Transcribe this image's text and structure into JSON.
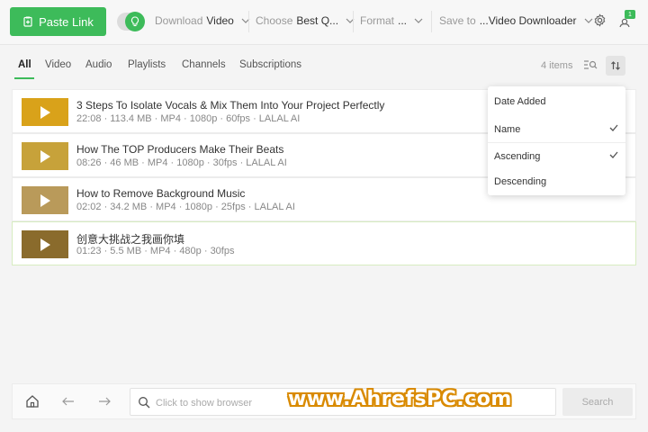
{
  "toolbar": {
    "paste_link_label": "Paste Link",
    "download_label": "Download",
    "download_value": "Video",
    "choose_label": "Choose",
    "choose_value": "Best Q...",
    "format_label": "Format",
    "format_value": "...",
    "save_to_label": "Save to",
    "save_to_value": "...Video Downloader",
    "badge_count": "1",
    "accent_color": "#3dbb5a"
  },
  "tabs": [
    {
      "label": "All",
      "active": true
    },
    {
      "label": "Video"
    },
    {
      "label": "Audio"
    },
    {
      "label": "Playlists"
    },
    {
      "label": "Channels"
    },
    {
      "label": "Subscriptions"
    }
  ],
  "items_count": "4 items",
  "list": [
    {
      "title": "3 Steps To Isolate Vocals & Mix Them Into Your Project Perfectly",
      "meta": "22:08 · 113.4 MB · MP4 · 1080p · 60fps · LALAL AI",
      "thumb_color": "#d9a21a"
    },
    {
      "title": "How The TOP Producers Make Their Beats",
      "meta": "08:26 · 46 MB · MP4 · 1080p · 30fps · LALAL AI",
      "thumb_color": "#c7a23a"
    },
    {
      "title": "How to Remove Background Music",
      "meta": "02:02 · 34.2 MB · MP4 · 1080p · 25fps · LALAL AI",
      "thumb_color": "#b99a5a"
    },
    {
      "title": "创意大挑战之我画你填",
      "meta": "01:23 · 5.5 MB · MP4 · 480p · 30fps",
      "thumb_color": "#8a6b2c"
    }
  ],
  "sort_menu": {
    "date_added": "Date Added",
    "name": "Name",
    "ascending": "Ascending",
    "descending": "Descending",
    "name_checked": true,
    "ascending_checked": true
  },
  "bottom": {
    "browser_placeholder": "Click to show browser",
    "search_label": "Search"
  },
  "watermark": "www.AhrefsPC.com"
}
